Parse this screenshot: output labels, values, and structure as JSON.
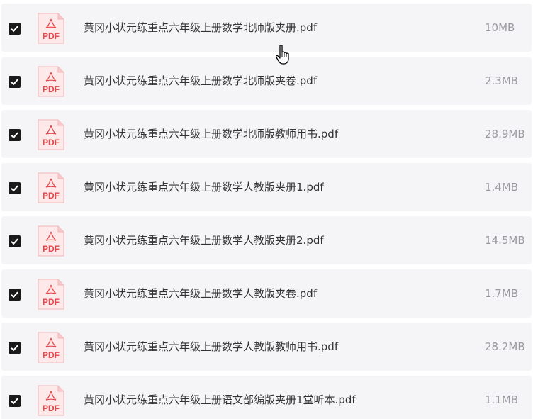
{
  "files": [
    {
      "name": "黄冈小状元练重点六年级上册数学北师版夹册.pdf",
      "size": "10MB",
      "checked": true,
      "icon": "pdf-file-icon",
      "badge": "PDF"
    },
    {
      "name": "黄冈小状元练重点六年级上册数学北师版夹卷.pdf",
      "size": "2.3MB",
      "checked": true,
      "icon": "pdf-file-icon",
      "badge": "PDF"
    },
    {
      "name": "黄冈小状元练重点六年级上册数学北师版教师用书.pdf",
      "size": "28.9MB",
      "checked": true,
      "icon": "pdf-file-icon",
      "badge": "PDF"
    },
    {
      "name": "黄冈小状元练重点六年级上册数学人教版夹册1.pdf",
      "size": "1.4MB",
      "checked": true,
      "icon": "pdf-file-icon",
      "badge": "PDF"
    },
    {
      "name": "黄冈小状元练重点六年级上册数学人教版夹册2.pdf",
      "size": "14.5MB",
      "checked": true,
      "icon": "pdf-file-icon",
      "badge": "PDF"
    },
    {
      "name": "黄冈小状元练重点六年级上册数学人教版夹卷.pdf",
      "size": "1.7MB",
      "checked": true,
      "icon": "pdf-file-icon",
      "badge": "PDF"
    },
    {
      "name": "黄冈小状元练重点六年级上册数学人教版教师用书.pdf",
      "size": "28.2MB",
      "checked": true,
      "icon": "pdf-file-icon",
      "badge": "PDF"
    },
    {
      "name": "黄冈小状元练重点六年级上册语文部编版夹册1堂听本.pdf",
      "size": "1.1MB",
      "checked": true,
      "icon": "pdf-file-icon",
      "badge": "PDF"
    }
  ],
  "colors": {
    "row_background": "#f5f5f7",
    "checkbox": "#1a1a1a",
    "pdf_red": "#e5474b",
    "pdf_icon_bg": "#fde9ea",
    "name_text": "#333333",
    "size_text": "#9a9aa0"
  },
  "cursor": {
    "icon": "hand-pointer-icon"
  }
}
